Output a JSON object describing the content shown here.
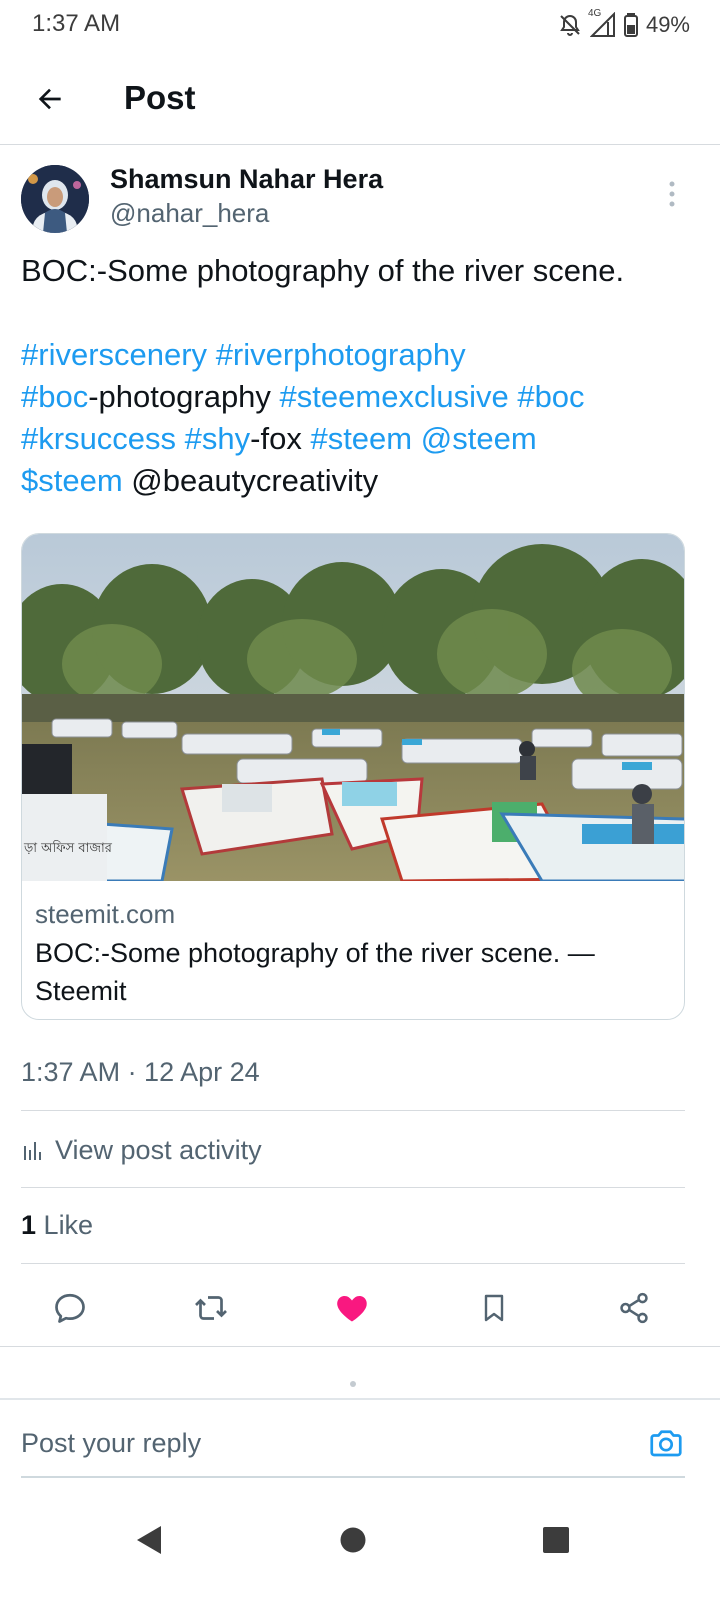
{
  "status_bar": {
    "time": "1:37 AM",
    "network": "4G",
    "battery": "49%"
  },
  "header": {
    "title": "Post"
  },
  "author": {
    "name": "Shamsun Nahar Hera",
    "handle": "@nahar_hera"
  },
  "post": {
    "first_line": "BOC:-Some photography of the river scene.",
    "line2": [
      "#riverscenery",
      "#riverphotography"
    ],
    "line3": [
      "#boc",
      "-photography ",
      "#steemexclusive",
      "#boc"
    ],
    "line4": [
      "#krsuccess",
      "#shy",
      "-fox ",
      "#steem",
      "@steem"
    ],
    "line5": [
      "$steem",
      "@beautycreativity"
    ]
  },
  "link_card": {
    "domain": "steemit.com",
    "title": "BOC:-Some photography of the river scene. — Steemit",
    "image_overlay_text": "ড়া অফিস বাজার"
  },
  "meta": {
    "timestamp": "1:37 AM · 12 Apr 24",
    "activity_label": "View post activity",
    "likes_count": "1",
    "likes_label": "Like"
  },
  "actions": {
    "icons": [
      "reply-icon",
      "repost-icon",
      "like-icon",
      "bookmark-icon",
      "share-icon"
    ],
    "like_color": "#f91880",
    "icon_color": "#536471"
  },
  "reply": {
    "placeholder": "Post your reply"
  },
  "colors": {
    "accent": "#1d9bf0",
    "text": "#0f1419",
    "secondary": "#536471"
  }
}
